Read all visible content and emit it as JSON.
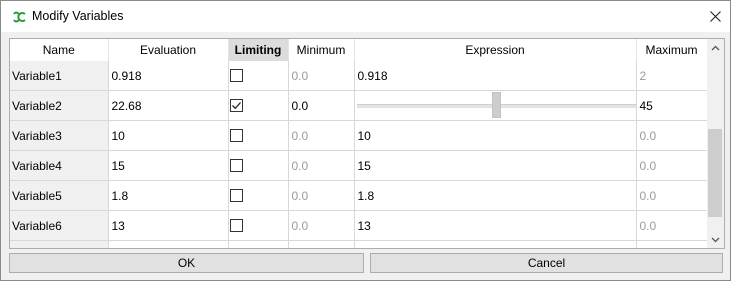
{
  "window": {
    "title": "Modify Variables",
    "app_icon": "freecad-spreadsheet-icon"
  },
  "table": {
    "columns": [
      "Name",
      "Evaluation",
      "Limiting",
      "Minimum",
      "Expression",
      "Maximum"
    ],
    "highlighted_column": "Limiting",
    "rows": [
      {
        "name": "Variable1",
        "evaluation": "0.918",
        "limiting": false,
        "minimum": "0.0",
        "expression": "0.918",
        "maximum": "2"
      },
      {
        "name": "Variable2",
        "evaluation": "22.68",
        "limiting": true,
        "minimum": "0.0",
        "expression": "",
        "slider_fraction": 0.504,
        "maximum": "45"
      },
      {
        "name": "Variable3",
        "evaluation": "10",
        "limiting": false,
        "minimum": "0.0",
        "expression": "10",
        "maximum": "0.0"
      },
      {
        "name": "Variable4",
        "evaluation": "15",
        "limiting": false,
        "minimum": "0.0",
        "expression": "15",
        "maximum": "0.0"
      },
      {
        "name": "Variable5",
        "evaluation": "1.8",
        "limiting": false,
        "minimum": "0.0",
        "expression": "1.8",
        "maximum": "0.0"
      },
      {
        "name": "Variable6",
        "evaluation": "13",
        "limiting": false,
        "minimum": "0.0",
        "expression": "13",
        "maximum": "0.0"
      },
      {
        "name": "",
        "evaluation": "",
        "limiting": null,
        "minimum": "",
        "expression": "",
        "maximum": ""
      }
    ]
  },
  "buttons": {
    "ok": "OK",
    "cancel": "Cancel"
  },
  "colors": {
    "dim_text": "#9b9b9b",
    "header_highlight": "#dcdcdc",
    "name_cell_bg": "#f0f0f0"
  }
}
